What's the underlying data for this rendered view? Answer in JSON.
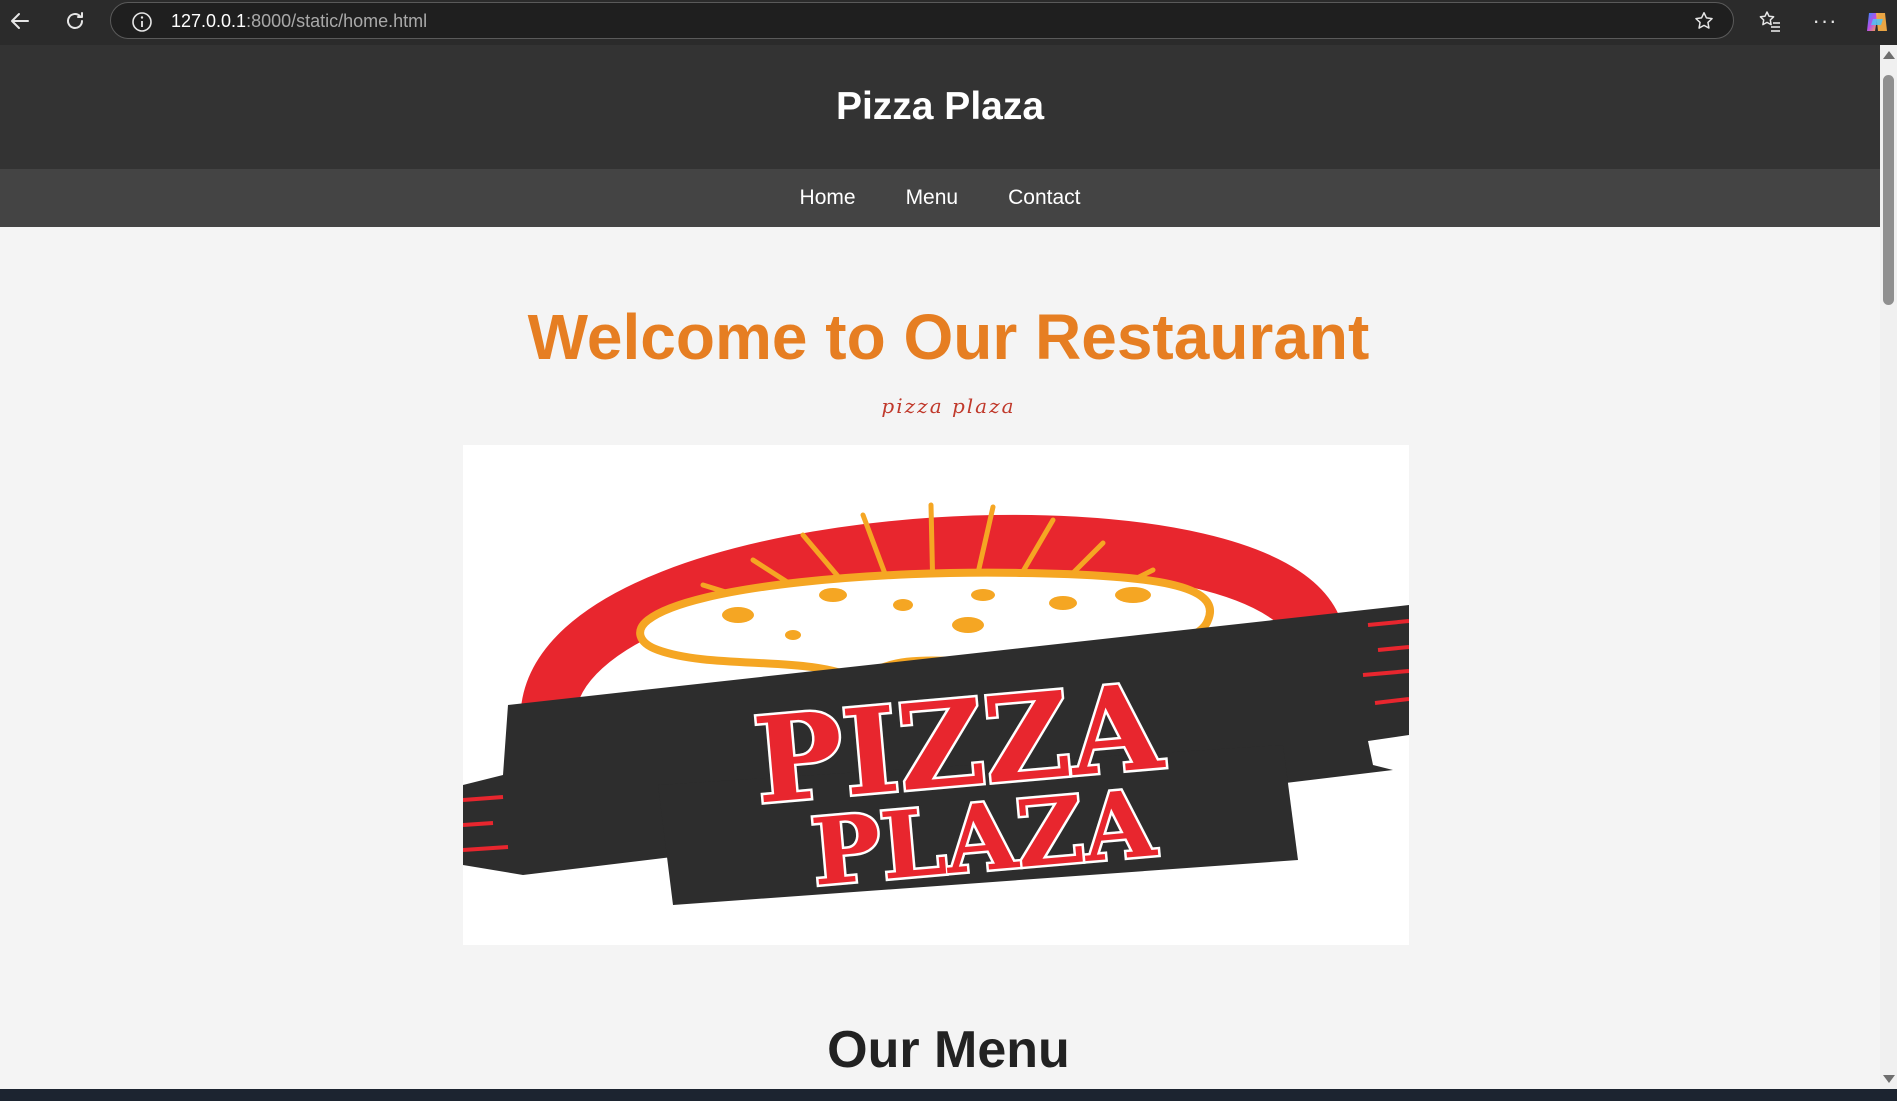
{
  "browser": {
    "url_host": "127.0.0.1",
    "url_path": ":8000/static/home.html",
    "icons": [
      "back-arrow-icon",
      "reload-icon",
      "info-icon",
      "star-icon",
      "favorites-icon",
      "more-icon",
      "copilot-icon"
    ]
  },
  "site": {
    "title": "Pizza Plaza",
    "nav": [
      "Home",
      "Menu",
      "Contact"
    ]
  },
  "hero": {
    "heading": "Welcome to Our Restaurant",
    "tagline": "pizza plaza"
  },
  "logo": {
    "line1": "PIZZA",
    "line2": "PLAZA"
  },
  "next_section": {
    "heading": "Our Menu"
  },
  "colors": {
    "header_bg": "#333333",
    "nav_bg": "#444444",
    "accent": "#e67e22",
    "tagline": "#c0392b",
    "logo_red": "#e8262e",
    "logo_dark": "#2d2d2d",
    "logo_orange": "#f5a623"
  }
}
